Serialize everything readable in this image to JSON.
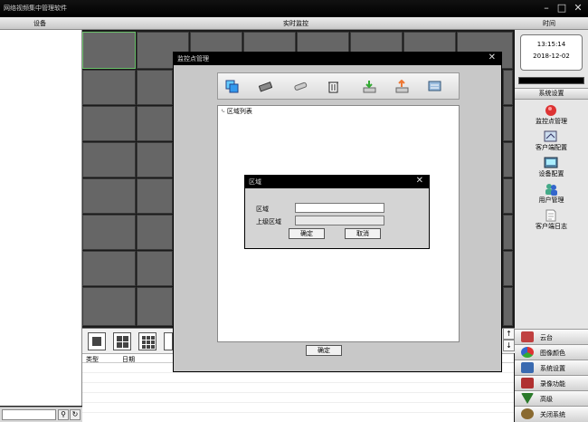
{
  "app": {
    "title": "网络视频集中管理软件"
  },
  "header": {
    "device_col": "设备",
    "monitor_col": "实时监控",
    "time_col": "时间"
  },
  "clock": {
    "time": "13:15:14",
    "date": "2018-12-02"
  },
  "sysconfig": {
    "header": "系统设置",
    "items": [
      {
        "label": "监控点管理",
        "icon": "camera-point-icon"
      },
      {
        "label": "客户端配置",
        "icon": "client-config-icon"
      },
      {
        "label": "设备配置",
        "icon": "device-config-icon"
      },
      {
        "label": "用户管理",
        "icon": "user-manage-icon"
      },
      {
        "label": "客户端日志",
        "icon": "client-log-icon"
      }
    ]
  },
  "menu": {
    "items": [
      {
        "label": "云台",
        "icon": "ptz-icon",
        "color": "#c04040"
      },
      {
        "label": "图像颜色",
        "icon": "color-icon",
        "color": "#3a8a3a"
      },
      {
        "label": "系统设置",
        "icon": "settings-icon",
        "color": "#3a6ab0"
      },
      {
        "label": "录像功能",
        "icon": "record-icon",
        "color": "#b03030"
      },
      {
        "label": "高级",
        "icon": "advanced-icon",
        "color": "#2a7a2a"
      },
      {
        "label": "关闭系统",
        "icon": "shutdown-icon",
        "color": "#8a6a30"
      }
    ]
  },
  "log": {
    "col_type": "类型",
    "col_date": "日期"
  },
  "monitor_dialog": {
    "title": "监控点管理",
    "tree_root": "区域列表",
    "ok_label": "确定",
    "tools": [
      "add-area-icon",
      "add-device-icon",
      "edit-icon",
      "delete-icon",
      "import-icon",
      "export-icon",
      "refresh-icon"
    ]
  },
  "area_dialog": {
    "title": "区域",
    "area_label": "区域",
    "area_value": "",
    "parent_label": "上级区域",
    "parent_value": "",
    "ok_label": "确定",
    "cancel_label": "取消"
  },
  "colors": {
    "accent_green": "#6ac16a",
    "cell_gray": "#666666",
    "titlebar": "#000000"
  }
}
